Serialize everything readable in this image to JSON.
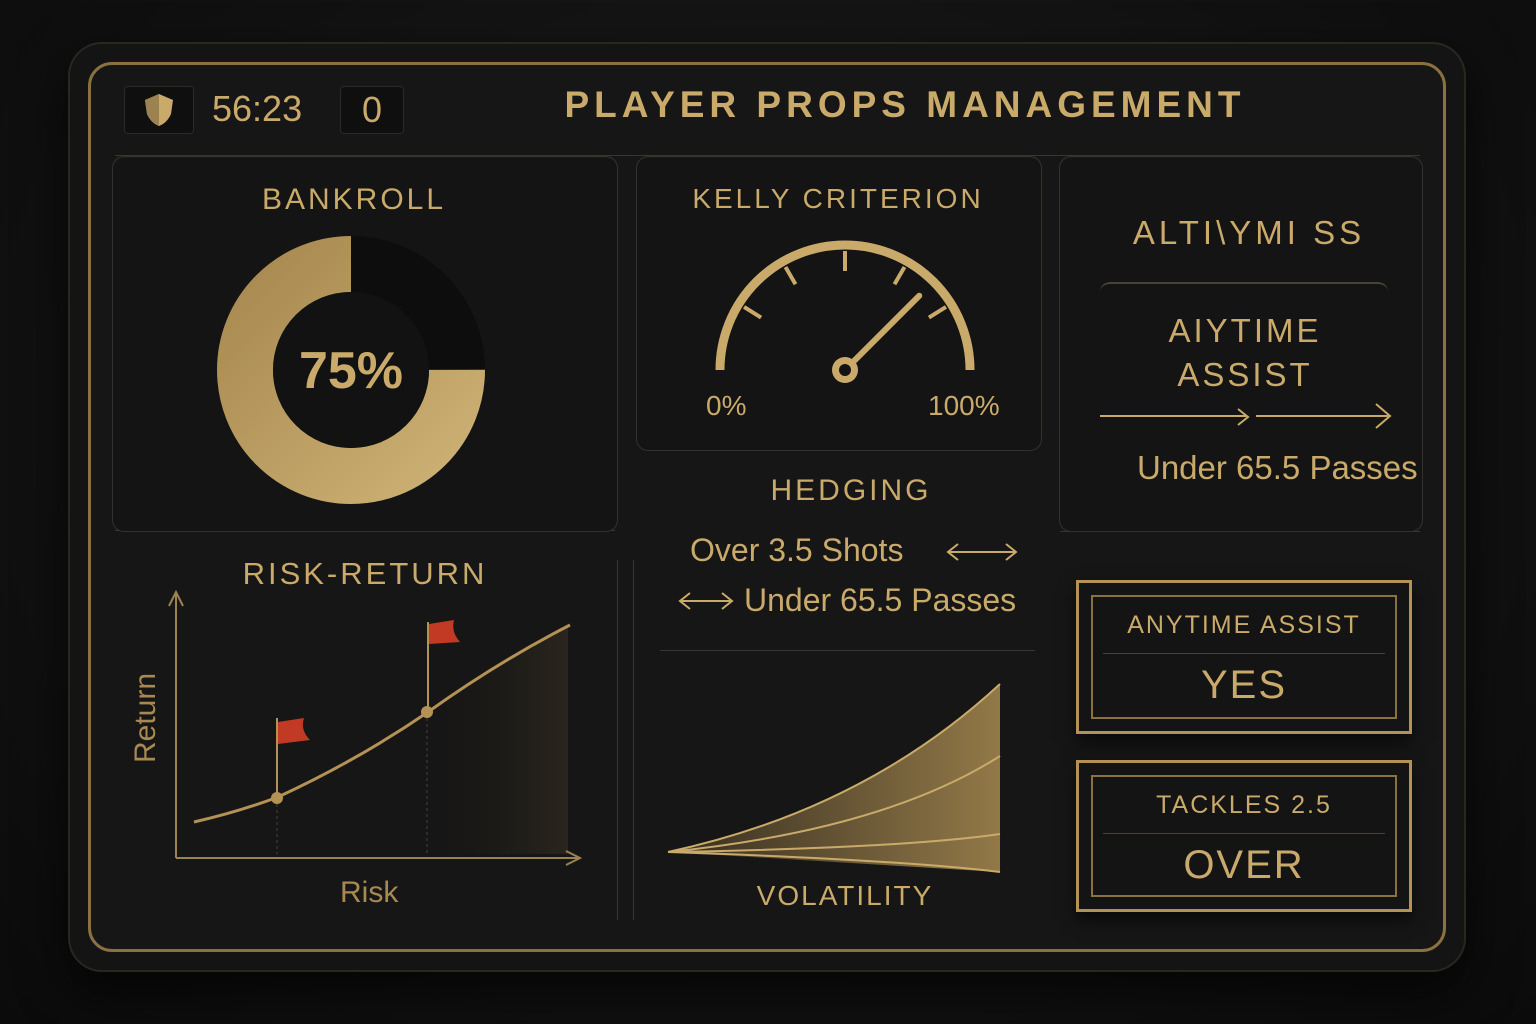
{
  "header": {
    "timer": "56:23",
    "score": "0",
    "title": "PLAYER PROPS MANAGEMENT"
  },
  "bankroll": {
    "label": "BANKROLL",
    "value_text": "75%",
    "fraction": 0.75
  },
  "kelly": {
    "label": "KELLY CRITERION",
    "min_label": "0%",
    "max_label": "100%",
    "needle_fraction": 0.75
  },
  "alt_panel": {
    "title": "ALTI\\YMI SS",
    "line1": "AIYTIME",
    "line2": "ASSIST",
    "subtitle": "Under 65.5 Passes"
  },
  "hedging": {
    "label": "HEDGING",
    "line1": "Over 3.5 Shots",
    "line2": "Under 65.5 Passes"
  },
  "risk_return": {
    "label": "RISK-RETURN",
    "xlabel": "Risk",
    "ylabel": "Return"
  },
  "volatility": {
    "label": "VOLATILITY"
  },
  "cards": [
    {
      "top": "ANYTIME ASSIST",
      "bottom": "YES"
    },
    {
      "top": "TACKLES 2.5",
      "bottom": "OVER"
    }
  ],
  "colors": {
    "gold": "#c9aa6a",
    "gold_dark": "#8a7140",
    "flag_red": "#c23a24",
    "background": "#141414"
  },
  "icons": {
    "shield": "shield-icon",
    "arrows": "double-arrow-icon"
  }
}
